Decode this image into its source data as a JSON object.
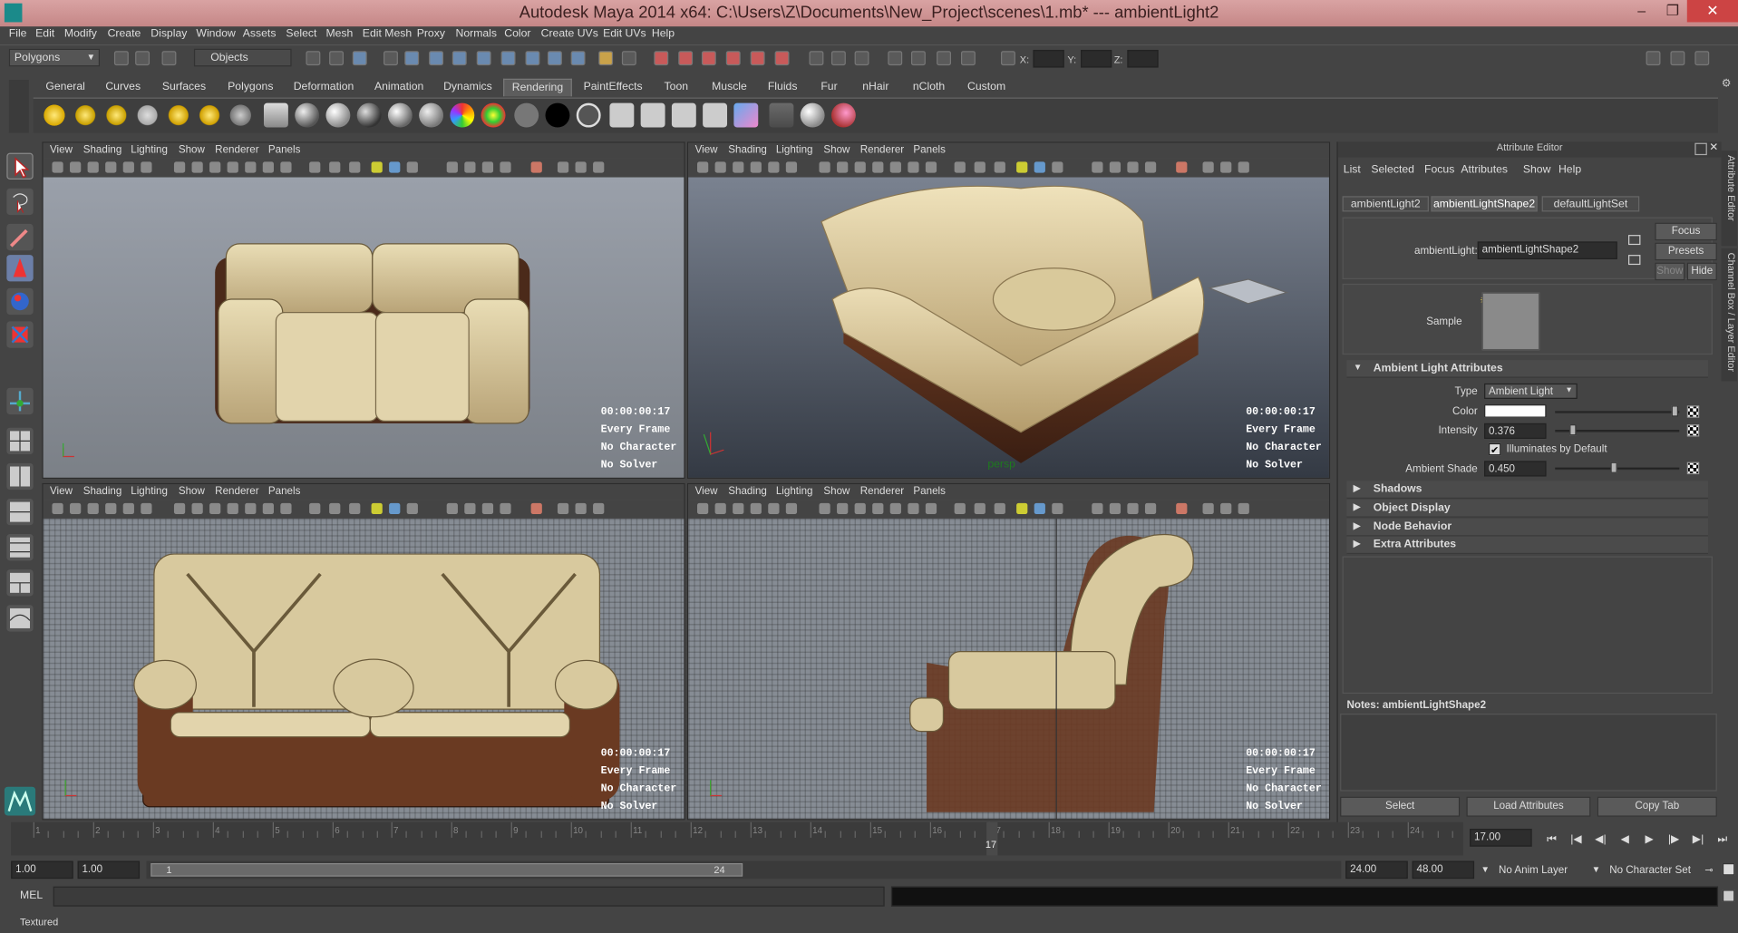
{
  "window": {
    "title": "Autodesk Maya 2014 x64: C:\\Users\\Z\\Documents\\New_Project\\scenes\\1.mb*   ---   ambientLight2",
    "minimize": "–",
    "restore": "❐",
    "close": "✕"
  },
  "menu": [
    "File",
    "Edit",
    "Modify",
    "Create",
    "Display",
    "Window",
    "Assets",
    "Select",
    "Mesh",
    "Edit Mesh",
    "Proxy",
    "Normals",
    "Color",
    "Create UVs",
    "Edit UVs",
    "Help"
  ],
  "status": {
    "mode": "Polygons",
    "selection_mask": "Objects",
    "x_label": "X:",
    "y_label": "Y:",
    "z_label": "Z:"
  },
  "shelf_tabs": [
    "General",
    "Curves",
    "Surfaces",
    "Polygons",
    "Deformation",
    "Animation",
    "Dynamics",
    "Rendering",
    "PaintEffects",
    "Toon",
    "Muscle",
    "Fluids",
    "Fur",
    "nHair",
    "nCloth",
    "Custom"
  ],
  "shelf_active_tab": "Rendering",
  "panel_menu": [
    "View",
    "Shading",
    "Lighting",
    "Show",
    "Renderer",
    "Panels"
  ],
  "hud": {
    "timecode": "00:00:00:17",
    "playback": "Every Frame",
    "character": "No Character",
    "solver": "No Solver"
  },
  "attribute_editor": {
    "title": "Attribute Editor",
    "menu": [
      "List",
      "Selected",
      "Focus",
      "Attributes",
      "Show",
      "Help"
    ],
    "tabs": [
      "ambientLight2",
      "ambientLightShape2",
      "defaultLightSet"
    ],
    "node_label": "ambientLight:",
    "node_value": "ambientLightShape2",
    "focus_btn": "Focus",
    "presets_btn": "Presets",
    "show_btn": "Show",
    "hide_btn": "Hide",
    "sample_label": "Sample",
    "section_main": "Ambient Light Attributes",
    "type_label": "Type",
    "type_value": "Ambient Light",
    "color_label": "Color",
    "intensity_label": "Intensity",
    "intensity_value": "0.376",
    "illuminates_label": "Illuminates by Default",
    "ambient_shade_label": "Ambient Shade",
    "ambient_shade_value": "0.450",
    "sections": [
      "Shadows",
      "Object Display",
      "Node Behavior",
      "Extra Attributes"
    ],
    "notes": "Notes: ambientLightShape2",
    "select_btn": "Select",
    "load_btn": "Load Attributes",
    "copy_btn": "Copy Tab",
    "side_tabs": "Attribute Editor",
    "side_tabs2": "Channel Box / Layer Editor"
  },
  "timeline": {
    "ticks": [
      "1",
      "2",
      "3",
      "4",
      "5",
      "6",
      "7",
      "8",
      "9",
      "10",
      "11",
      "12",
      "13",
      "14",
      "15",
      "16",
      "17",
      "18",
      "19",
      "20",
      "21",
      "22",
      "23",
      "24"
    ],
    "current": "17",
    "current_field": "17.00"
  },
  "range": {
    "start": "1.00",
    "start2": "1.00",
    "slider_start": "1",
    "slider_end": "24",
    "end": "24.00",
    "end2": "48.00",
    "anim_layer": "No Anim Layer",
    "char_set": "No Character Set"
  },
  "mel_label": "MEL",
  "help_text": "Textured"
}
